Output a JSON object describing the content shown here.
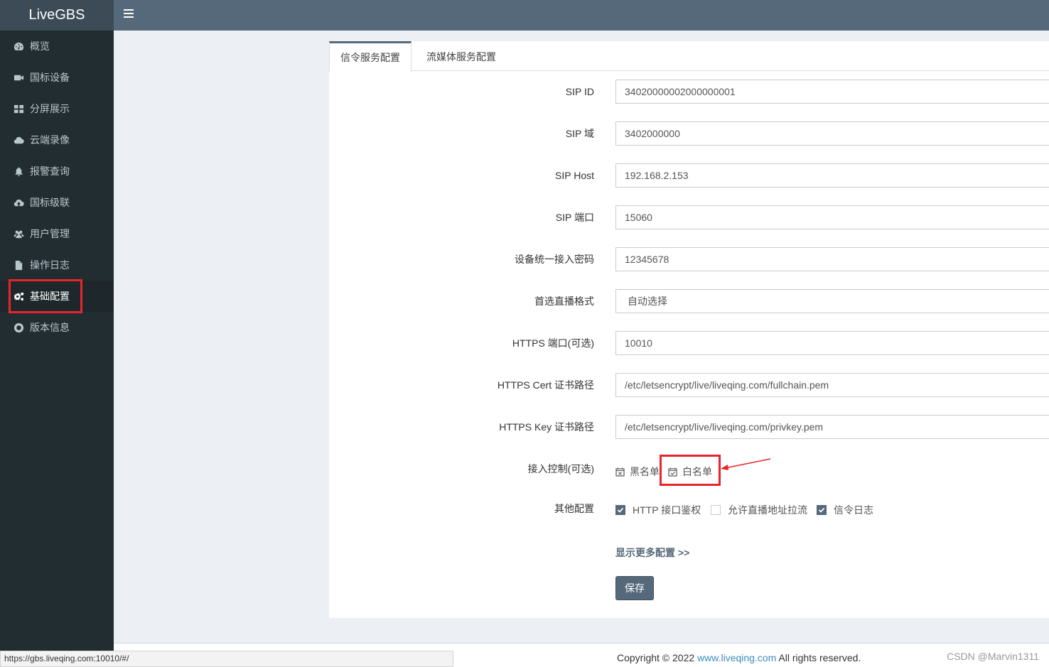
{
  "app": {
    "title": "LiveGBS"
  },
  "sidebar": {
    "items": [
      {
        "label": "概览",
        "icon": "dashboard-icon"
      },
      {
        "label": "国标设备",
        "icon": "video-camera-icon"
      },
      {
        "label": "分屏展示",
        "icon": "grid-icon"
      },
      {
        "label": "云端录像",
        "icon": "cloud-icon"
      },
      {
        "label": "报警查询",
        "icon": "bell-icon"
      },
      {
        "label": "国标级联",
        "icon": "cloud-upload-icon"
      },
      {
        "label": "用户管理",
        "icon": "users-icon"
      },
      {
        "label": "操作日志",
        "icon": "file-icon"
      },
      {
        "label": "基础配置",
        "icon": "gears-icon",
        "active": true
      },
      {
        "label": "版本信息",
        "icon": "life-ring-icon"
      }
    ]
  },
  "tabs": [
    {
      "label": "信令服务配置",
      "active": true
    },
    {
      "label": "流媒体服务配置",
      "active": false
    }
  ],
  "form": {
    "sip_id": {
      "label": "SIP ID",
      "value": "34020000002000000001"
    },
    "sip_domain": {
      "label": "SIP 域",
      "value": "3402000000"
    },
    "sip_host": {
      "label": "SIP Host",
      "value": "192.168.2.153"
    },
    "sip_port": {
      "label": "SIP 端口",
      "value": "15060"
    },
    "device_password": {
      "label": "设备统一接入密码",
      "value": "12345678"
    },
    "live_format": {
      "label": "首选直播格式",
      "value": "自动选择"
    },
    "https_port": {
      "label": "HTTPS 端口(可选)",
      "value": "10010"
    },
    "https_cert": {
      "label": "HTTPS Cert 证书路径",
      "value": "/etc/letsencrypt/live/liveqing.com/fullchain.pem"
    },
    "https_key": {
      "label": "HTTPS Key 证书路径",
      "value": "/etc/letsencrypt/live/liveqing.com/privkey.pem"
    },
    "access_control": {
      "label": "接入控制(可选)",
      "options": [
        "黑名单",
        "白名单"
      ]
    },
    "other": {
      "label": "其他配置",
      "options": [
        {
          "label": "HTTP 接口鉴权",
          "checked": true
        },
        {
          "label": "允许直播地址拉流",
          "checked": false
        },
        {
          "label": "信令日志",
          "checked": true
        }
      ]
    },
    "more_link": "显示更多配置 >>",
    "save_label": "保存"
  },
  "footer": {
    "copyright_prefix": "Copyright © 2022 ",
    "link": "www.liveqing.com",
    "copyright_suffix": " All rights reserved.",
    "watermark": "CSDN @Marvin1311"
  },
  "statusbar": {
    "url": "https://gbs.liveqing.com:10010/#/"
  },
  "colors": {
    "accent": "#56697a",
    "sidebar": "#222d32",
    "highlight": "#e6262b"
  }
}
